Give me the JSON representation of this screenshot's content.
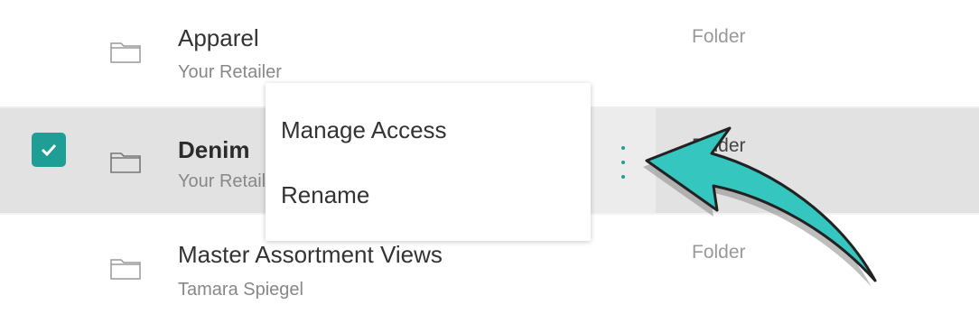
{
  "items": [
    {
      "name": "Apparel",
      "owner": "Your Retailer",
      "type": "Folder",
      "selected": false
    },
    {
      "name": "Denim",
      "owner": "Your Retailer",
      "type": "Folder",
      "selected": true
    },
    {
      "name": "Master Assortment Views",
      "owner": "Tamara Spiegel",
      "type": "Folder",
      "selected": false
    }
  ],
  "context_menu": {
    "items": [
      "Manage Access",
      "Rename"
    ]
  },
  "colors": {
    "accent": "#1f9e96",
    "selected_row": "#e2e2e2",
    "arrow_fill": "#34c6bf",
    "arrow_outline": "#222222"
  },
  "icons": {
    "folder": "folder-icon",
    "check": "checkmark-icon",
    "more": "more-vertical-icon"
  }
}
